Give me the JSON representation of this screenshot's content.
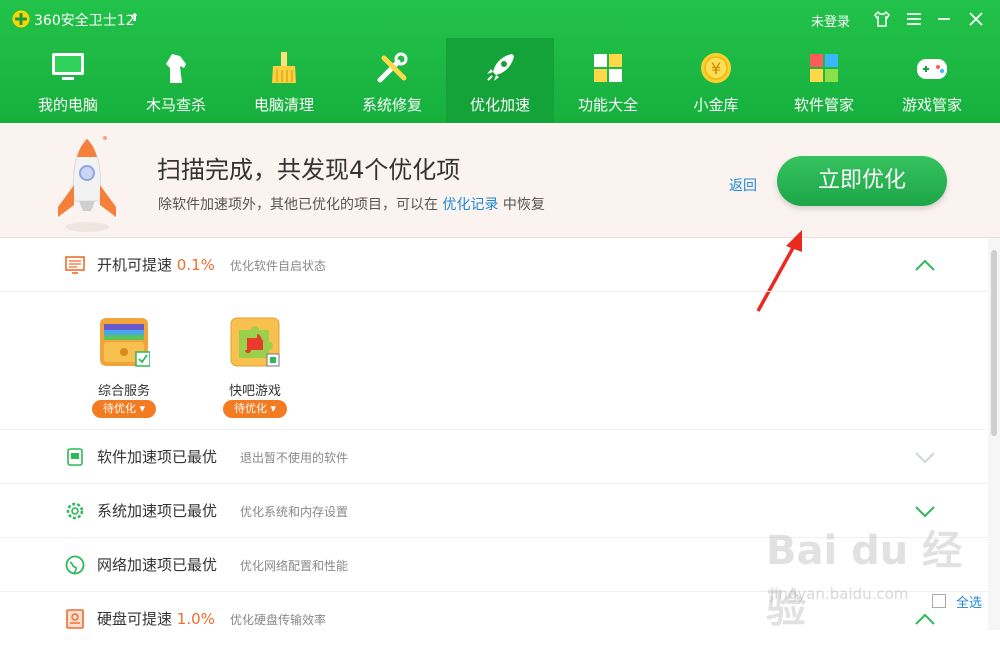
{
  "titlebar": {
    "app_title": "360安全卫士12",
    "login": "未登录"
  },
  "tabs": [
    {
      "label": "我的电脑",
      "icon": "monitor-icon",
      "active": false
    },
    {
      "label": "木马查杀",
      "icon": "horse-icon",
      "active": false
    },
    {
      "label": "电脑清理",
      "icon": "broom-icon",
      "active": false
    },
    {
      "label": "系统修复",
      "icon": "tools-icon",
      "active": false
    },
    {
      "label": "优化加速",
      "icon": "rocket-icon",
      "active": true
    },
    {
      "label": "功能大全",
      "icon": "apps-grid-icon",
      "active": false
    },
    {
      "label": "小金库",
      "icon": "coin-icon",
      "active": false
    },
    {
      "label": "软件管家",
      "icon": "software-icon",
      "active": false
    },
    {
      "label": "游戏管家",
      "icon": "gamepad-icon",
      "active": false
    }
  ],
  "banner": {
    "title": "扫描完成，共发现4个优化项",
    "subtitle_pre": "除软件加速项外，其他已优化的项目，可以在",
    "subtitle_link": "优化记录",
    "subtitle_post": "中恢复",
    "back": "返回",
    "optimize_button": "立即优化"
  },
  "rows": [
    {
      "title": "开机可提速",
      "pct": "0.1%",
      "desc": "优化软件自启状态",
      "expanded": true,
      "icon": "startup-icon"
    },
    {
      "title": "软件加速项已最优",
      "pct": "",
      "desc": "退出暂不使用的软件",
      "expanded": false,
      "icon": "software-speed-icon"
    },
    {
      "title": "系统加速项已最优",
      "pct": "",
      "desc": "优化系统和内存设置",
      "expanded": false,
      "icon": "system-gear-icon"
    },
    {
      "title": "网络加速项已最优",
      "pct": "",
      "desc": "优化网络配置和性能",
      "expanded": false,
      "icon": "network-globe-icon"
    },
    {
      "title": "硬盘可提速",
      "pct": "1.0%",
      "desc": "优化硬盘传输效率",
      "expanded": true,
      "icon": "disk-icon"
    }
  ],
  "startup_items": [
    {
      "name": "综合服务",
      "status": "待优化",
      "icon": "service-folder-icon"
    },
    {
      "name": "快吧游戏",
      "status": "待优化",
      "icon": "puzzle-game-icon"
    }
  ],
  "footer": {
    "select_all": "全选"
  },
  "watermark": {
    "main": "Bai du 经验",
    "sub": "jingyan.baidu.com"
  },
  "colors": {
    "header_green": "#1fba45",
    "accent_orange": "#f06c2a",
    "link_blue": "#1e88d8",
    "button_green": "#27ad52"
  }
}
